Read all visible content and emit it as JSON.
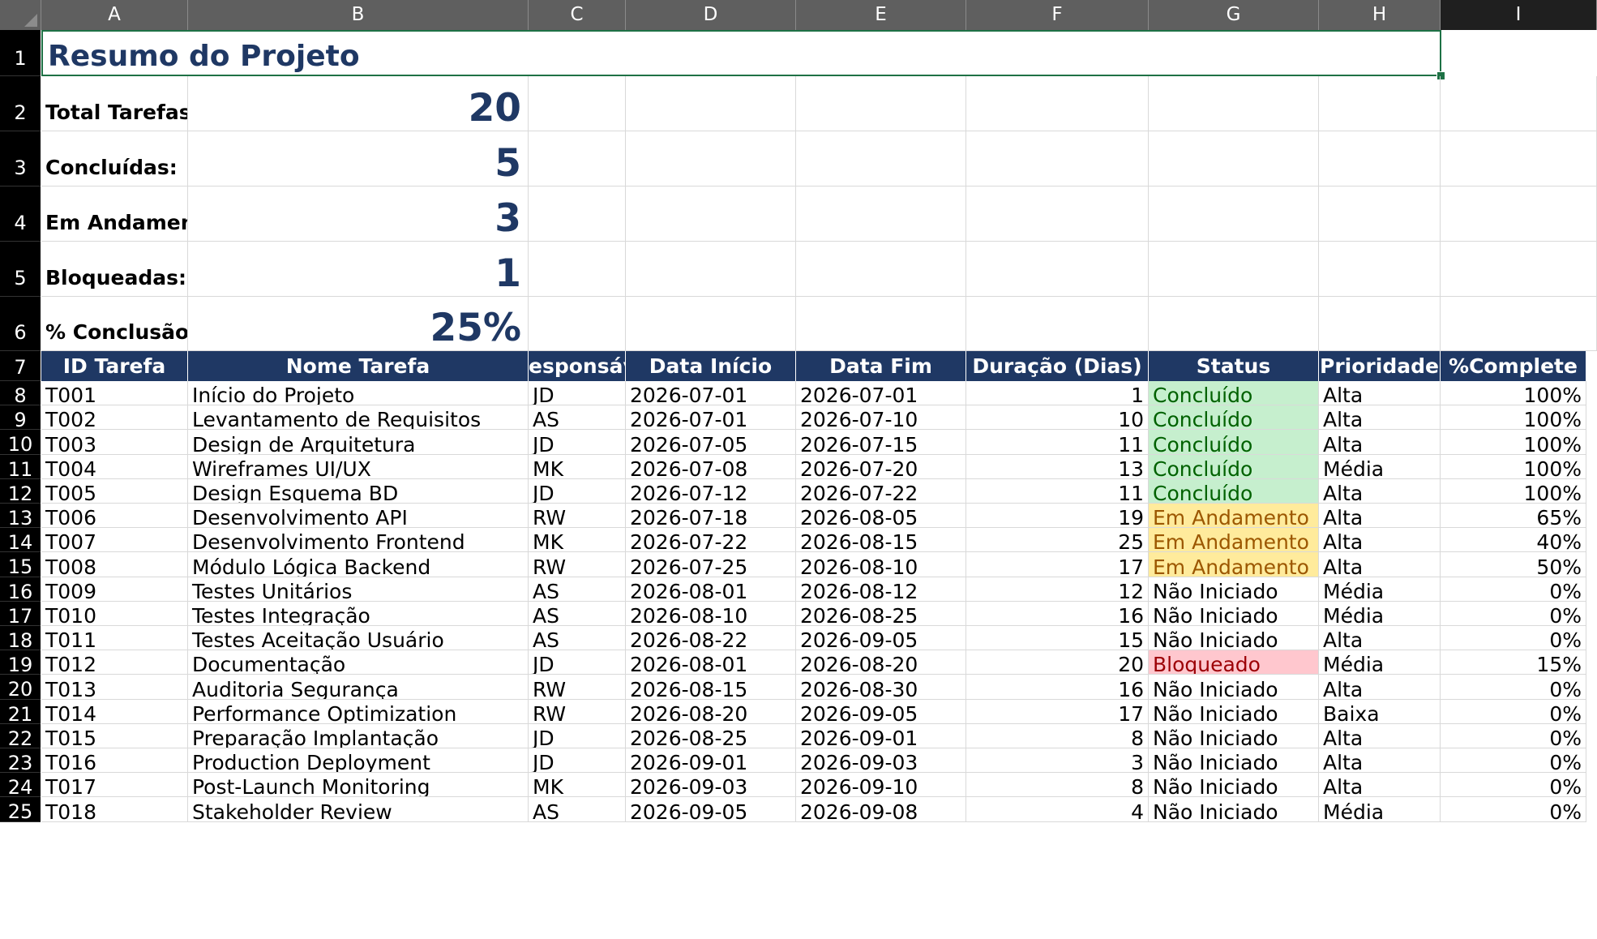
{
  "columns": [
    "A",
    "B",
    "C",
    "D",
    "E",
    "F",
    "G",
    "H",
    "I"
  ],
  "rows": [
    "1",
    "2",
    "3",
    "4",
    "5",
    "6",
    "7",
    "8",
    "9",
    "10",
    "11",
    "12",
    "13",
    "14",
    "15",
    "16",
    "17",
    "18",
    "19",
    "20",
    "21",
    "22",
    "23",
    "24",
    "25"
  ],
  "title": "Resumo do Projeto",
  "summary": [
    {
      "label": "Total Tarefas:",
      "value": "20"
    },
    {
      "label": "Concluídas:",
      "value": "5"
    },
    {
      "label": "Em Andament",
      "value": "3"
    },
    {
      "label": "Bloqueadas:",
      "value": "1"
    },
    {
      "label": "% Conclusão:",
      "value": "25%"
    }
  ],
  "table": {
    "headers": [
      "ID Tarefa",
      "Nome Tarefa",
      "esponsáve",
      "Data Início",
      "Data Fim",
      "Duração (Dias)",
      "Status",
      "Prioridade",
      "%Complete"
    ],
    "rows": [
      [
        "T001",
        "Início do Projeto",
        "JD",
        "2026-07-01",
        "2026-07-01",
        "1",
        "Concluído",
        "Alta",
        "100%"
      ],
      [
        "T002",
        "Levantamento de Requisitos",
        "AS",
        "2026-07-01",
        "2026-07-10",
        "10",
        "Concluído",
        "Alta",
        "100%"
      ],
      [
        "T003",
        "Design de Arquitetura",
        "JD",
        "2026-07-05",
        "2026-07-15",
        "11",
        "Concluído",
        "Alta",
        "100%"
      ],
      [
        "T004",
        "Wireframes UI/UX",
        "MK",
        "2026-07-08",
        "2026-07-20",
        "13",
        "Concluído",
        "Média",
        "100%"
      ],
      [
        "T005",
        "Design Esquema BD",
        "JD",
        "2026-07-12",
        "2026-07-22",
        "11",
        "Concluído",
        "Alta",
        "100%"
      ],
      [
        "T006",
        "Desenvolvimento API",
        "RW",
        "2026-07-18",
        "2026-08-05",
        "19",
        "Em Andamento",
        "Alta",
        "65%"
      ],
      [
        "T007",
        "Desenvolvimento Frontend",
        "MK",
        "2026-07-22",
        "2026-08-15",
        "25",
        "Em Andamento",
        "Alta",
        "40%"
      ],
      [
        "T008",
        "Módulo Lógica Backend",
        "RW",
        "2026-07-25",
        "2026-08-10",
        "17",
        "Em Andamento",
        "Alta",
        "50%"
      ],
      [
        "T009",
        "Testes Unitários",
        "AS",
        "2026-08-01",
        "2026-08-12",
        "12",
        "Não Iniciado",
        "Média",
        "0%"
      ],
      [
        "T010",
        "Testes Integração",
        "AS",
        "2026-08-10",
        "2026-08-25",
        "16",
        "Não Iniciado",
        "Média",
        "0%"
      ],
      [
        "T011",
        "Testes Aceitação Usuário",
        "AS",
        "2026-08-22",
        "2026-09-05",
        "15",
        "Não Iniciado",
        "Alta",
        "0%"
      ],
      [
        "T012",
        "Documentação",
        "JD",
        "2026-08-01",
        "2026-08-20",
        "20",
        "Bloqueado",
        "Média",
        "15%"
      ],
      [
        "T013",
        "Auditoria Segurança",
        "RW",
        "2026-08-15",
        "2026-08-30",
        "16",
        "Não Iniciado",
        "Alta",
        "0%"
      ],
      [
        "T014",
        "Performance Optimization",
        "RW",
        "2026-08-20",
        "2026-09-05",
        "17",
        "Não Iniciado",
        "Baixa",
        "0%"
      ],
      [
        "T015",
        "Preparação Implantação",
        "JD",
        "2026-08-25",
        "2026-09-01",
        "8",
        "Não Iniciado",
        "Alta",
        "0%"
      ],
      [
        "T016",
        "Production Deployment",
        "JD",
        "2026-09-01",
        "2026-09-03",
        "3",
        "Não Iniciado",
        "Alta",
        "0%"
      ],
      [
        "T017",
        "Post-Launch Monitoring",
        "MK",
        "2026-09-03",
        "2026-09-10",
        "8",
        "Não Iniciado",
        "Alta",
        "0%"
      ],
      [
        "T018",
        "Stakeholder Review",
        "AS",
        "2026-09-05",
        "2026-09-08",
        "4",
        "Não Iniciado",
        "Média",
        "0%"
      ]
    ]
  },
  "status_colors": {
    "Concluído": {
      "bg": "#c6efce",
      "fg": "#006100"
    },
    "Em Andamento": {
      "bg": "#ffeb9c",
      "fg": "#9c5700"
    },
    "Bloqueado": {
      "bg": "#ffc7ce",
      "fg": "#9c0006"
    }
  },
  "colors": {
    "header_fill": "#1f3864",
    "title_text": "#1f3864",
    "selection_border": "#1e7145"
  }
}
